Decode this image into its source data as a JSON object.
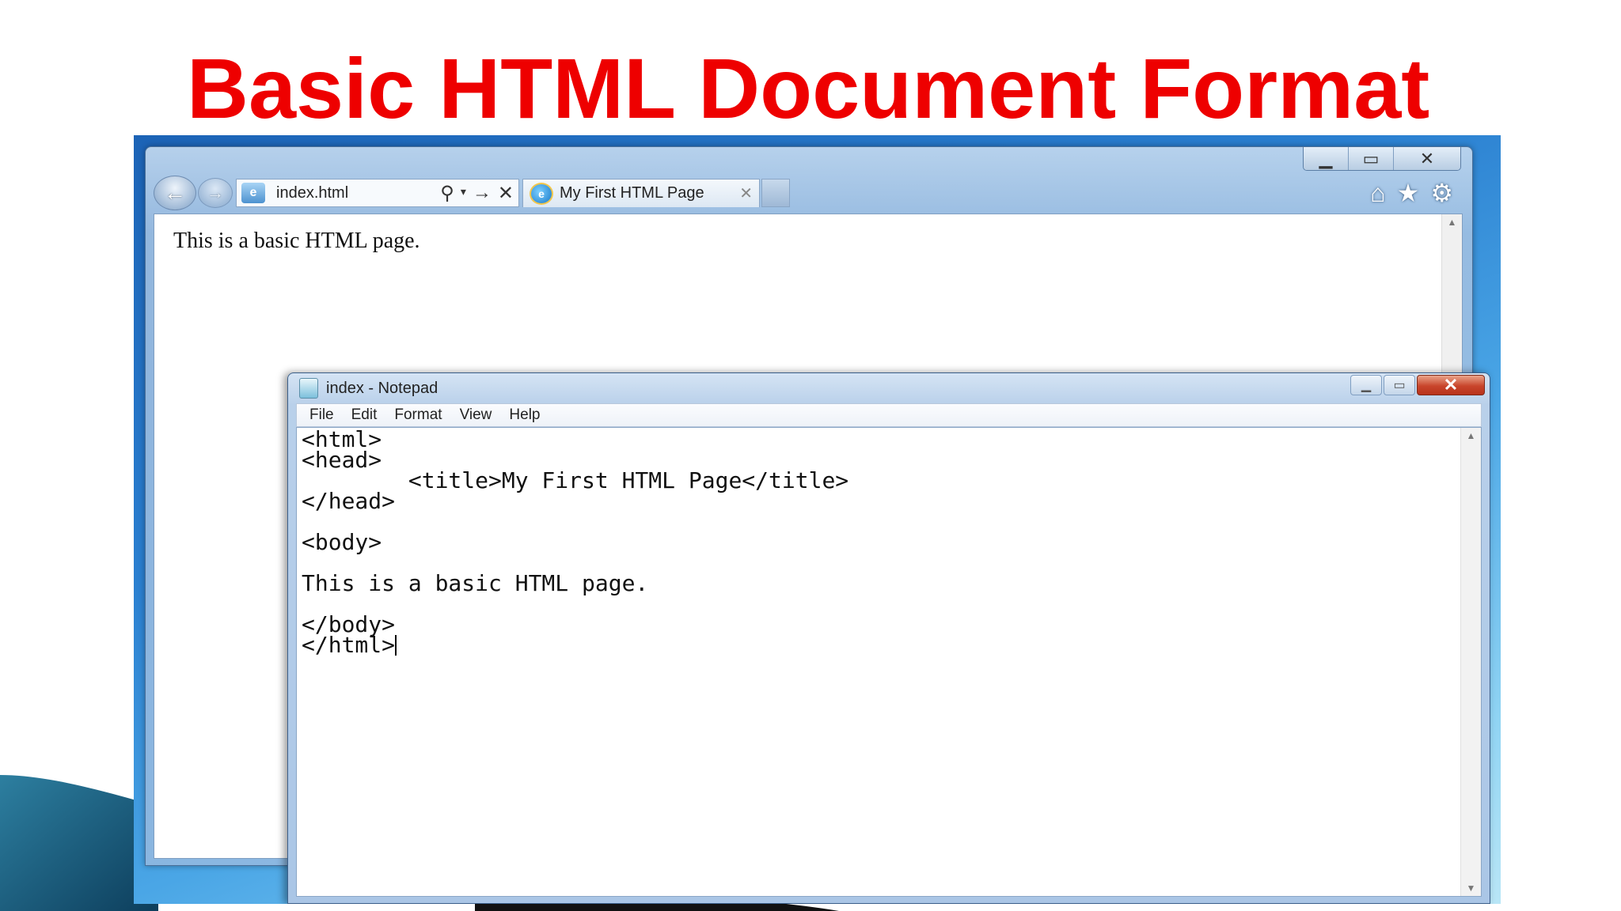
{
  "slide": {
    "title": "Basic HTML Document Format"
  },
  "browser": {
    "address": "index.html",
    "address_actions": [
      "search-icon",
      "dropdown-icon",
      "go-icon",
      "stop-icon"
    ],
    "tab_label": "My First HTML Page",
    "tab_close": "✕",
    "page_text": "This is a basic HTML page.",
    "tools": [
      "home-icon",
      "favorites-icon",
      "settings-icon"
    ]
  },
  "notepad": {
    "title": "index - Notepad",
    "menu": [
      "File",
      "Edit",
      "Format",
      "View",
      "Help"
    ],
    "code_lines": [
      "<html>",
      "<head>",
      "        <title>My First HTML Page</title>",
      "</head>",
      "",
      "<body>",
      "",
      "This is a basic HTML page.",
      "",
      "</body>",
      "</html>"
    ]
  },
  "colors": {
    "title_red": "#ee0000",
    "desktop_blue": "#2a7fd0"
  }
}
